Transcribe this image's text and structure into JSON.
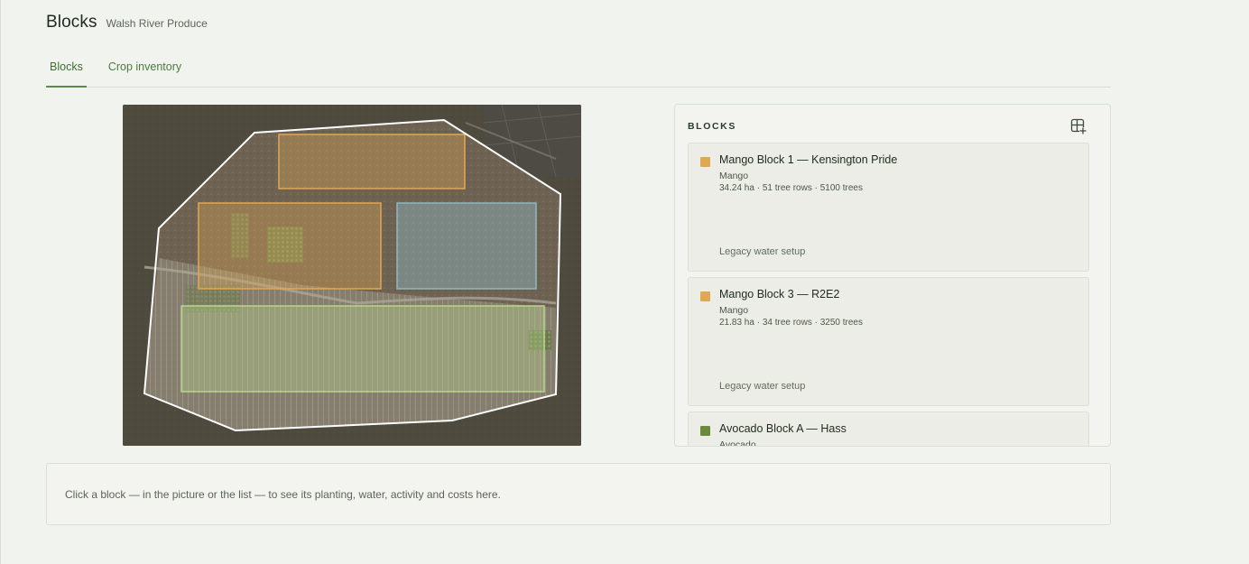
{
  "header": {
    "title": "Blocks",
    "subtitle": "Walsh River Produce"
  },
  "tabs": [
    {
      "label": "Blocks",
      "active": true
    },
    {
      "label": "Crop inventory",
      "active": false
    }
  ],
  "map": {
    "icon": "aerial-farm-image"
  },
  "panel": {
    "title": "BLOCKS",
    "add_icon": "add-block-icon",
    "blocks": [
      {
        "name": "Mango Block 1 — Kensington Pride",
        "crop": "Mango",
        "stats": "34.24 ha · 51 tree rows · 5100 trees",
        "water": "Legacy water setup",
        "color": "#e0a852"
      },
      {
        "name": "Mango Block 3 — R2E2",
        "crop": "Mango",
        "stats": "21.83 ha · 34 tree rows · 3250 trees",
        "water": "Legacy water setup",
        "color": "#e0a852"
      },
      {
        "name": "Avocado Block A — Hass",
        "crop": "Avocado",
        "stats": "",
        "water": "",
        "color": "#6b8a3c"
      }
    ]
  },
  "info": {
    "text": "Click a block — in the picture or the list — to see its planting, water, activity and costs here."
  },
  "colors": {
    "accent": "#5b8b4a",
    "mango": "#e0a852",
    "avocado": "#6b8a3c",
    "water_block": "#8fb8c0",
    "green_block": "#b8d68c"
  }
}
